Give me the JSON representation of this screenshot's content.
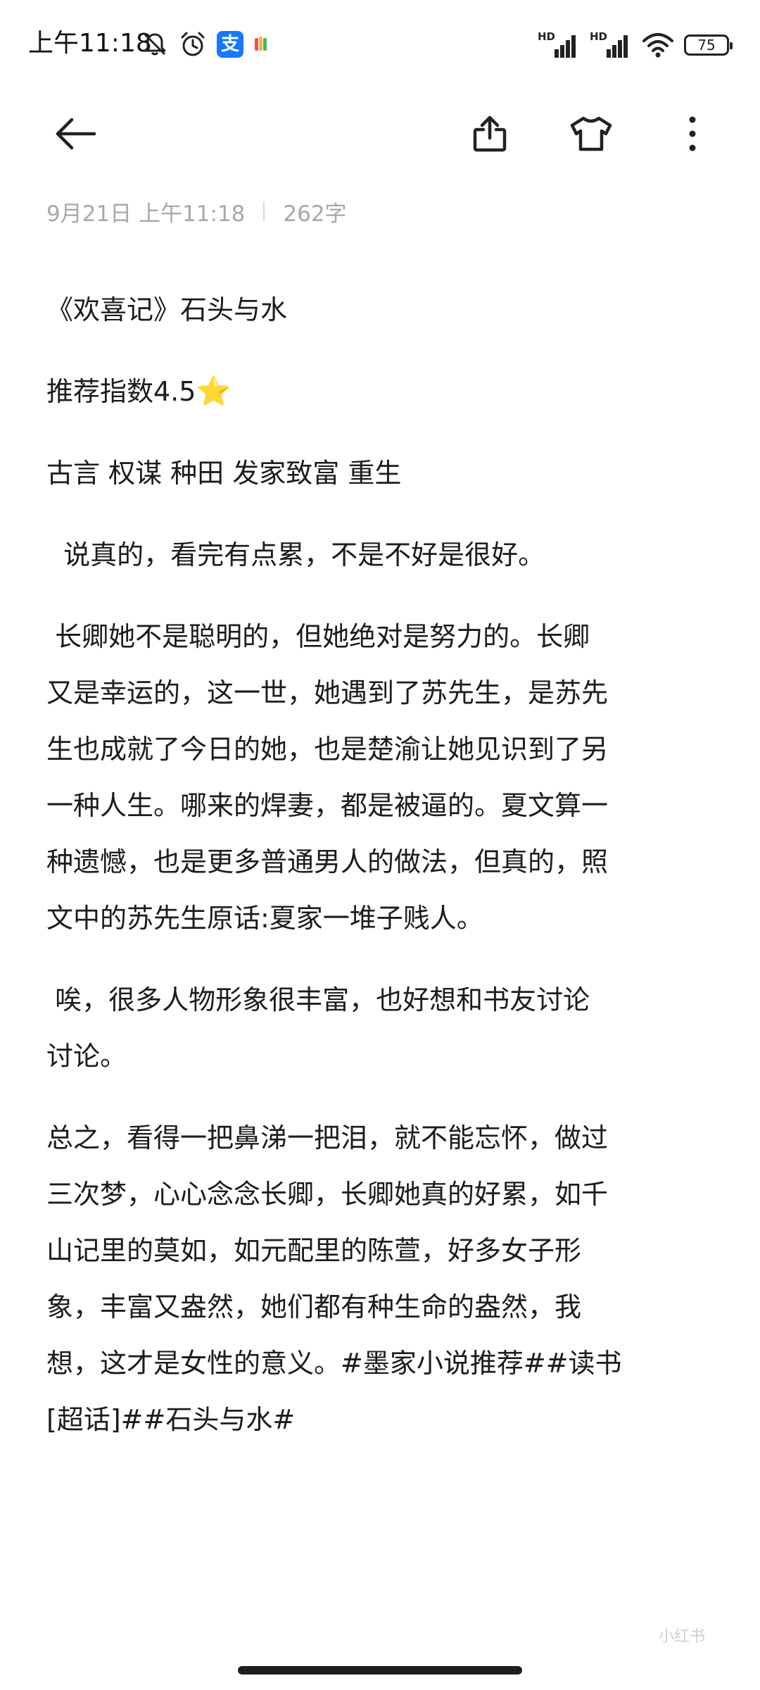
{
  "status_bar": {
    "time": "上午11:18",
    "battery": "75",
    "signal_label_1": "HD",
    "signal_label_2": "HD",
    "alipay_glyph": "支",
    "alipay_color": "#1677ff",
    "icons": [
      "bell-off-icon",
      "alarm-clock-icon",
      "alipay-icon",
      "color-app-icon",
      "hd-signal-icon",
      "wifi-icon",
      "battery-icon"
    ]
  },
  "toolbar": {
    "icons": [
      "back-arrow-icon",
      "share-icon",
      "theme-shirt-icon",
      "more-vertical-icon"
    ]
  },
  "meta": {
    "date": "9月21日 上午11:18",
    "word_count": "262字"
  },
  "note": {
    "p1": "《欢喜记》石头与水",
    "p2": "推荐指数4.5",
    "p2_star": "⭐",
    "p3": "古言 权谋 种田 发家致富 重生",
    "p4": "  说真的，看完有点累，不是不好是很好。",
    "p5_l1": " 长卿她不是聪明的，但她绝对是努力的。长卿",
    "p5_l2": "又是幸运的，这一世，她遇到了苏先生，是苏先",
    "p5_l3": "生也成就了今日的她，也是楚渝让她见识到了另",
    "p5_l4": "一种人生。哪来的焊妻，都是被逼的。夏文算一",
    "p5_l5": "种遗憾，也是更多普通男人的做法，但真的，照",
    "p5_l6": "文中的苏先生原话:夏家一堆子贱人。",
    "p6_l1": " 唉，很多人物形象很丰富，也好想和书友讨论",
    "p6_l2": "讨论。",
    "p7_l1": "总之，看得一把鼻涕一把泪，就不能忘怀，做过",
    "p7_l2": "三次梦，心心念念长卿，长卿她真的好累，如千",
    "p7_l3": "山记里的莫如，如元配里的陈萱，好多女子形",
    "p7_l4": "象，丰富又盎然，她们都有种生命的盎然，我",
    "p7_l5": "想，这才是女性的意义。#墨家小说推荐##读书",
    "p7_l6": "[超话]##石头与水#"
  },
  "watermark": "小红书"
}
